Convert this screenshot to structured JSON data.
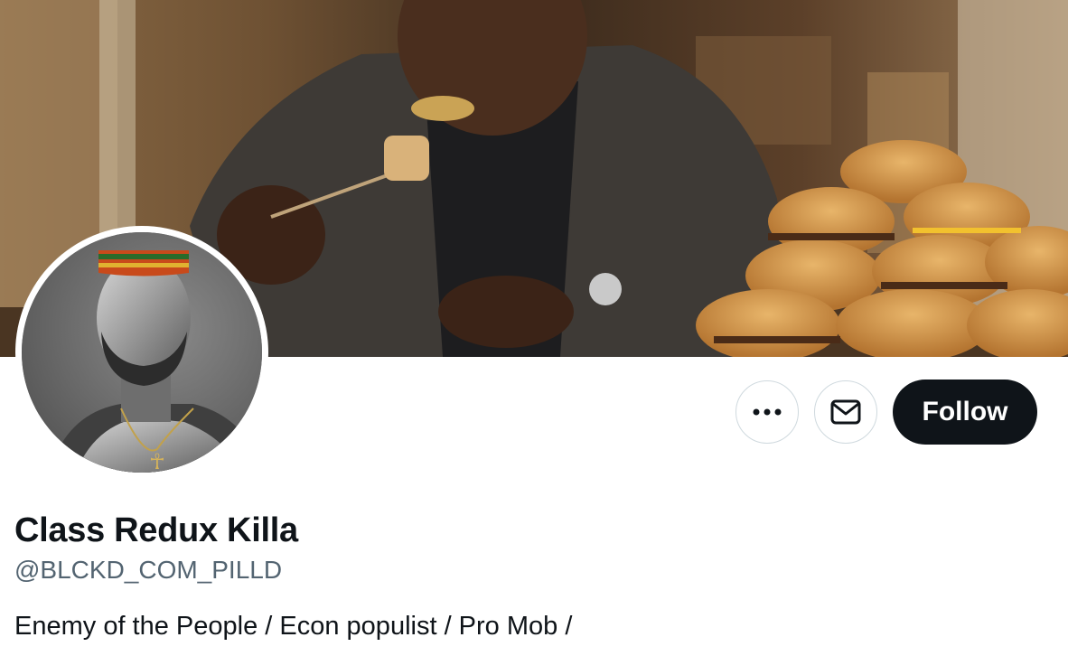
{
  "profile": {
    "display_name": "Class Redux Killa",
    "handle": "@BLCKD_COM_PILLD",
    "bio": "Enemy of the People / Econ populist / Pro Mob /"
  },
  "actions": {
    "more_icon": "more-horizontal-icon",
    "message_icon": "envelope-icon",
    "follow_label": "Follow"
  },
  "banner": {
    "description_icon": "header-photo"
  },
  "colors": {
    "follow_bg": "#0f1419",
    "follow_text": "#ffffff",
    "handle_text": "#536471",
    "button_border": "#cfd9de"
  }
}
